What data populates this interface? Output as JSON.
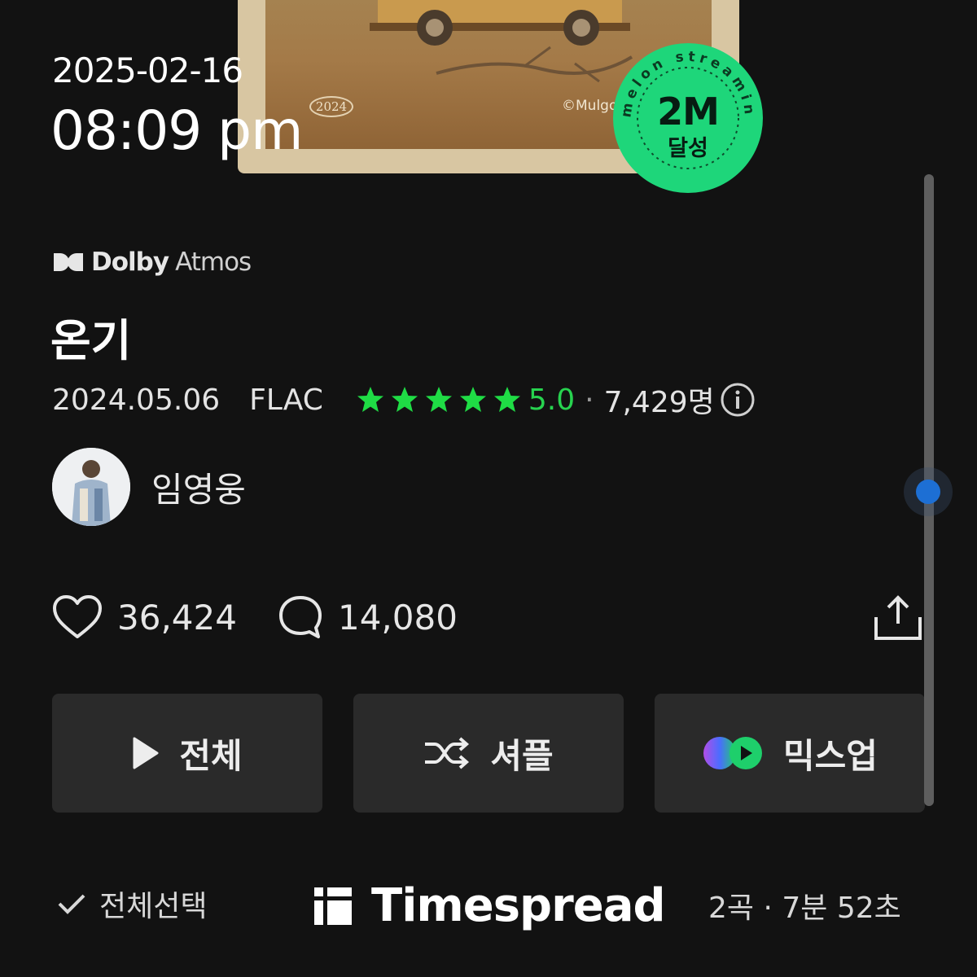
{
  "overlay": {
    "date": "2025-02-16",
    "time": "08:09 pm"
  },
  "album_art": {
    "year_stamp": "2024",
    "copyright": "©Mulgo"
  },
  "badge": {
    "ring_text": "melon streaming",
    "main": "2M",
    "sub": "달성",
    "color": "#1ed67a"
  },
  "audio_badge": {
    "dolby": "Dolby",
    "atmos": "Atmos"
  },
  "album": {
    "title": "온기",
    "release_date": "2024.05.06",
    "format": "FLAC",
    "rating": "5.0",
    "rating_stars": 5,
    "rating_count": "7,429명",
    "star_color": "#1fdc45"
  },
  "artist": {
    "name": "임영웅"
  },
  "stats": {
    "likes": "36,424",
    "comments": "14,080"
  },
  "buttons": {
    "play_all": "전체",
    "shuffle": "셔플",
    "mixup": "믹스업"
  },
  "track_list": {
    "select_all": "전체선택",
    "summary": "2곡 · 7분 52초"
  },
  "watermark": {
    "text": "Timespread"
  },
  "icons": [
    "dolby-icon",
    "star-icon",
    "info-icon",
    "heart-icon",
    "comment-icon",
    "share-icon",
    "play-icon",
    "shuffle-icon",
    "mixup-icon",
    "check-icon",
    "timespread-logo-icon"
  ]
}
